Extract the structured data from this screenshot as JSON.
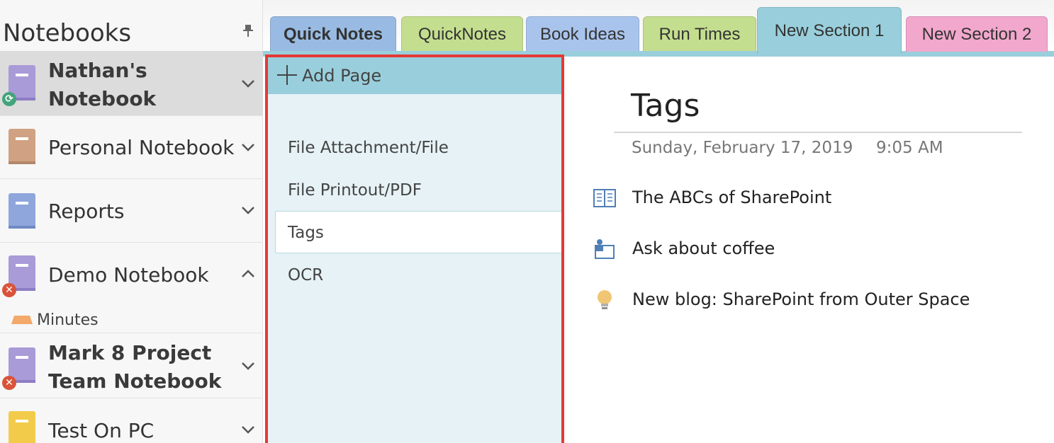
{
  "sidebar": {
    "title": "Notebooks",
    "notebooks": [
      {
        "label_line1": "Nathan's",
        "label_line2": "Notebook",
        "color": "#a99ad8"
      },
      {
        "label": "Personal Notebook",
        "color": "#d0a182"
      },
      {
        "label": "Reports",
        "color": "#8ea6dc"
      },
      {
        "label": "Demo Notebook",
        "color": "#a99ad8"
      },
      {
        "label_line1": "Mark 8 Project",
        "label_line2": "Team Notebook",
        "color": "#a99ad8"
      },
      {
        "label": "Test On PC",
        "color": "#f2cb4a"
      }
    ],
    "section": {
      "label": "Minutes",
      "color": "#f2a96a"
    }
  },
  "tabs": [
    {
      "label": "Quick Notes",
      "color": "#99bbe3"
    },
    {
      "label": "QuickNotes",
      "color": "#c4de8f"
    },
    {
      "label": "Book Ideas",
      "color": "#a9c4ec"
    },
    {
      "label": "Run Times",
      "color": "#c4de8f"
    },
    {
      "label": "New Section 1",
      "color": "#99cfdc"
    },
    {
      "label": "New Section 2",
      "color": "#f2a7cc"
    }
  ],
  "pages": {
    "add_label": "Add Page",
    "items": [
      {
        "label": "File Attachment/File"
      },
      {
        "label": "File Printout/PDF"
      },
      {
        "label": "Tags"
      },
      {
        "label": "OCR"
      }
    ]
  },
  "note": {
    "title": "Tags",
    "date": "Sunday, February 17, 2019",
    "time": "9:05 AM",
    "items": [
      {
        "text": "The ABCs of SharePoint",
        "icon": "book-icon"
      },
      {
        "text": "Ask about coffee",
        "icon": "contact-icon"
      },
      {
        "text": "New blog: SharePoint from Outer Space",
        "icon": "lightbulb-icon"
      }
    ]
  }
}
